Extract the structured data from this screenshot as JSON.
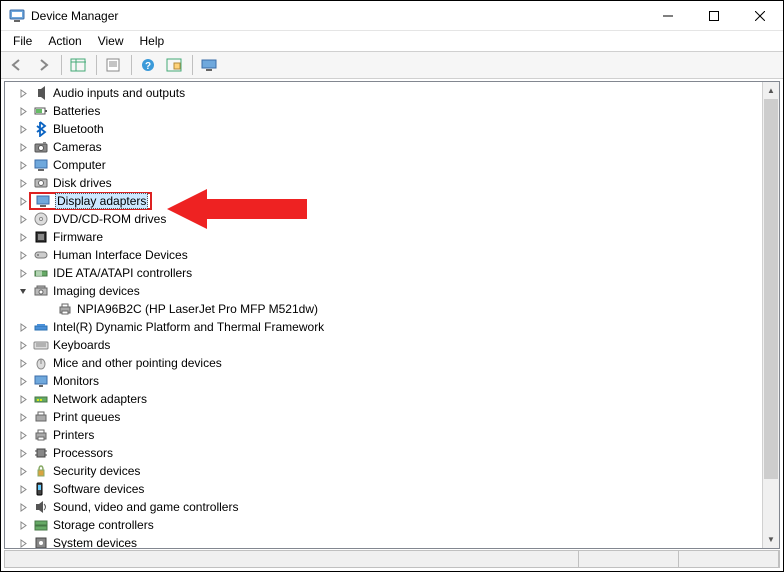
{
  "window": {
    "title": "Device Manager"
  },
  "menu": {
    "file": "File",
    "action": "Action",
    "view": "View",
    "help": "Help"
  },
  "tree": {
    "items": [
      {
        "label": "Audio inputs and outputs",
        "expanded": false,
        "selected": false,
        "indent": 0,
        "icon": "audio"
      },
      {
        "label": "Batteries",
        "expanded": false,
        "selected": false,
        "indent": 0,
        "icon": "battery"
      },
      {
        "label": "Bluetooth",
        "expanded": false,
        "selected": false,
        "indent": 0,
        "icon": "bluetooth"
      },
      {
        "label": "Cameras",
        "expanded": false,
        "selected": false,
        "indent": 0,
        "icon": "camera"
      },
      {
        "label": "Computer",
        "expanded": false,
        "selected": false,
        "indent": 0,
        "icon": "computer"
      },
      {
        "label": "Disk drives",
        "expanded": false,
        "selected": false,
        "indent": 0,
        "icon": "disk"
      },
      {
        "label": "Display adapters",
        "expanded": false,
        "selected": true,
        "indent": 0,
        "icon": "display"
      },
      {
        "label": "DVD/CD-ROM drives",
        "expanded": false,
        "selected": false,
        "indent": 0,
        "icon": "dvd"
      },
      {
        "label": "Firmware",
        "expanded": false,
        "selected": false,
        "indent": 0,
        "icon": "firmware"
      },
      {
        "label": "Human Interface Devices",
        "expanded": false,
        "selected": false,
        "indent": 0,
        "icon": "hid"
      },
      {
        "label": "IDE ATA/ATAPI controllers",
        "expanded": false,
        "selected": false,
        "indent": 0,
        "icon": "ide"
      },
      {
        "label": "Imaging devices",
        "expanded": true,
        "selected": false,
        "indent": 0,
        "icon": "imaging"
      },
      {
        "label": "NPIA96B2C (HP LaserJet Pro MFP M521dw)",
        "expanded": null,
        "selected": false,
        "indent": 1,
        "icon": "printer-device"
      },
      {
        "label": "Intel(R) Dynamic Platform and Thermal Framework",
        "expanded": false,
        "selected": false,
        "indent": 0,
        "icon": "intel"
      },
      {
        "label": "Keyboards",
        "expanded": false,
        "selected": false,
        "indent": 0,
        "icon": "keyboard"
      },
      {
        "label": "Mice and other pointing devices",
        "expanded": false,
        "selected": false,
        "indent": 0,
        "icon": "mouse"
      },
      {
        "label": "Monitors",
        "expanded": false,
        "selected": false,
        "indent": 0,
        "icon": "monitor"
      },
      {
        "label": "Network adapters",
        "expanded": false,
        "selected": false,
        "indent": 0,
        "icon": "network"
      },
      {
        "label": "Print queues",
        "expanded": false,
        "selected": false,
        "indent": 0,
        "icon": "printq"
      },
      {
        "label": "Printers",
        "expanded": false,
        "selected": false,
        "indent": 0,
        "icon": "printer"
      },
      {
        "label": "Processors",
        "expanded": false,
        "selected": false,
        "indent": 0,
        "icon": "cpu"
      },
      {
        "label": "Security devices",
        "expanded": false,
        "selected": false,
        "indent": 0,
        "icon": "security"
      },
      {
        "label": "Software devices",
        "expanded": false,
        "selected": false,
        "indent": 0,
        "icon": "software"
      },
      {
        "label": "Sound, video and game controllers",
        "expanded": false,
        "selected": false,
        "indent": 0,
        "icon": "sound"
      },
      {
        "label": "Storage controllers",
        "expanded": false,
        "selected": false,
        "indent": 0,
        "icon": "storage"
      },
      {
        "label": "System devices",
        "expanded": false,
        "selected": false,
        "indent": 0,
        "icon": "system"
      }
    ]
  }
}
